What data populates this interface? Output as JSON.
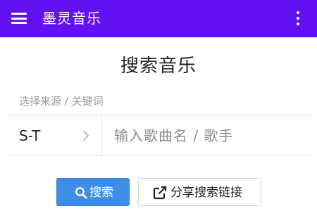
{
  "appbar": {
    "title": "墨灵音乐",
    "menu_icon": "hamburger-menu-icon",
    "more_icon": "more-vertical-icon",
    "color": "#6212f2"
  },
  "main": {
    "title": "搜索音乐",
    "source_label": "选择来源 / 关键词",
    "source_value": "S-T",
    "source_chevron_icon": "chevron-right-icon",
    "search_input": {
      "value": "",
      "placeholder": "输入歌曲名 / 歌手"
    }
  },
  "actions": {
    "search_button": {
      "label": "搜索",
      "icon": "search-icon",
      "color": "#3e8de8"
    },
    "share_button": {
      "label": "分享搜索链接",
      "icon": "external-link-icon"
    }
  }
}
